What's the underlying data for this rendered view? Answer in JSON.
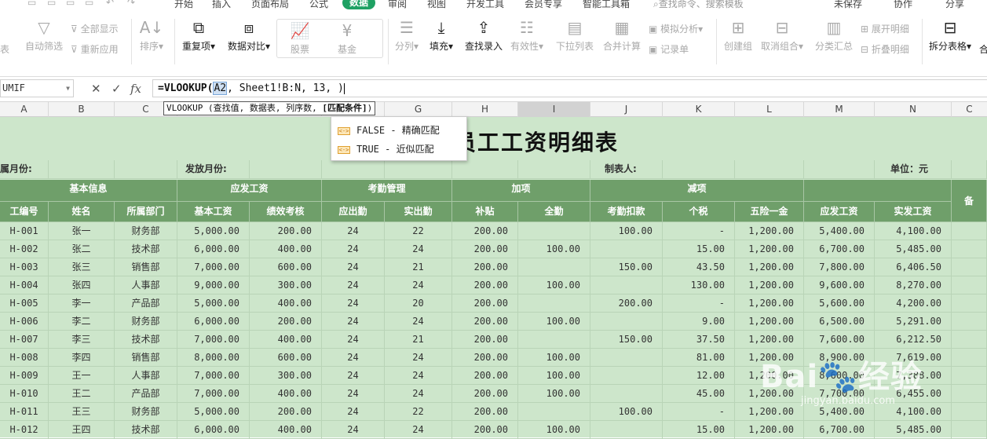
{
  "menubar": {
    "tabs": [
      "开始",
      "插入",
      "页面布局",
      "公式",
      "数据",
      "审阅",
      "视图",
      "开发工具",
      "会员专享",
      "智能工具箱"
    ],
    "active_tab": "数据",
    "search_hint": "查找命令、搜索模板",
    "right": [
      "未保存",
      "协作",
      "分享"
    ]
  },
  "ribbon": {
    "cut_left": "表",
    "auto_filter": "自动筛选",
    "show_all": "全部显示",
    "reapply": "重新应用",
    "sort": "排序",
    "duplicates": "重复项",
    "compare": "数据对比",
    "stock": "股票",
    "fund": "基金",
    "split": "分列",
    "fill": "填充",
    "lookup": "查找录入",
    "validity": "有效性",
    "dropdown": "下拉列表",
    "merge_calc": "合并计算",
    "simulate": "模拟分析",
    "record": "记录单",
    "create_group": "创建组",
    "ungroup": "取消组合",
    "subtotal": "分类汇总",
    "expand": "展开明细",
    "collapse": "折叠明细",
    "split_table": "拆分表格",
    "cut_right": "合"
  },
  "formula_bar": {
    "name_box": "UMIF",
    "fx": "fx",
    "prefix": "=VLOOKUP(",
    "ref": "A2",
    "suffix": ", Sheet1!B:N, 13, )"
  },
  "tooltip": {
    "text": "VLOOKUP (查找值, 数据表, 列序数, ",
    "bold": "[匹配条件]",
    "end": ")"
  },
  "autocomplete": [
    {
      "label": "FALSE - 精确匹配"
    },
    {
      "label": "TRUE - 近似匹配"
    }
  ],
  "columns": [
    "A",
    "B",
    "C",
    "",
    "",
    "G",
    "H",
    "I",
    "J",
    "K",
    "L",
    "M",
    "N",
    "C"
  ],
  "sheet": {
    "title": "员工工资明细表",
    "title_visible": "员工工资明细表",
    "info_row": {
      "month_label": "属月份:",
      "issue_label": "发放月份:",
      "maker_label": "制表人:",
      "unit": "单位：元"
    },
    "group_headers": {
      "basic": "基本信息",
      "salary": "应发工资",
      "attendance": "考勤管理",
      "plus": "加项",
      "minus": "减项",
      "remark": "备"
    },
    "headers": [
      "工编号",
      "姓名",
      "所属部门",
      "基本工资",
      "绩效考核",
      "应出勤",
      "实出勤",
      "补贴",
      "全勤",
      "考勤扣款",
      "个税",
      "五险一金",
      "应发工资",
      "实发工资"
    ],
    "rows": [
      [
        "H-001",
        "张一",
        "财务部",
        "5,000.00",
        "200.00",
        "24",
        "22",
        "200.00",
        "",
        "100.00",
        "-",
        "1,200.00",
        "5,400.00",
        "4,100.00"
      ],
      [
        "H-002",
        "张二",
        "技术部",
        "6,000.00",
        "400.00",
        "24",
        "24",
        "200.00",
        "100.00",
        "",
        "15.00",
        "1,200.00",
        "6,700.00",
        "5,485.00"
      ],
      [
        "H-003",
        "张三",
        "销售部",
        "7,000.00",
        "600.00",
        "24",
        "21",
        "200.00",
        "",
        "150.00",
        "43.50",
        "1,200.00",
        "7,800.00",
        "6,406.50"
      ],
      [
        "H-004",
        "张四",
        "人事部",
        "9,000.00",
        "300.00",
        "24",
        "24",
        "200.00",
        "100.00",
        "",
        "130.00",
        "1,200.00",
        "9,600.00",
        "8,270.00"
      ],
      [
        "H-005",
        "李一",
        "产品部",
        "5,000.00",
        "400.00",
        "24",
        "20",
        "200.00",
        "",
        "200.00",
        "-",
        "1,200.00",
        "5,600.00",
        "4,200.00"
      ],
      [
        "H-006",
        "李二",
        "财务部",
        "6,000.00",
        "200.00",
        "24",
        "24",
        "200.00",
        "100.00",
        "",
        "9.00",
        "1,200.00",
        "6,500.00",
        "5,291.00"
      ],
      [
        "H-007",
        "李三",
        "技术部",
        "7,000.00",
        "400.00",
        "24",
        "21",
        "200.00",
        "",
        "150.00",
        "37.50",
        "1,200.00",
        "7,600.00",
        "6,212.50"
      ],
      [
        "H-008",
        "李四",
        "销售部",
        "8,000.00",
        "600.00",
        "24",
        "24",
        "200.00",
        "100.00",
        "",
        "81.00",
        "1,200.00",
        "8,900.00",
        "7,619.00"
      ],
      [
        "H-009",
        "王一",
        "人事部",
        "7,000.00",
        "300.00",
        "24",
        "24",
        "200.00",
        "100.00",
        "",
        "12.00",
        "1,200.00",
        "8,600.00",
        "7,388.00"
      ],
      [
        "H-010",
        "王二",
        "产品部",
        "7,000.00",
        "400.00",
        "24",
        "24",
        "200.00",
        "100.00",
        "",
        "45.00",
        "1,200.00",
        "7,700.00",
        "6,455.00"
      ],
      [
        "H-011",
        "王三",
        "财务部",
        "5,000.00",
        "200.00",
        "24",
        "22",
        "200.00",
        "",
        "100.00",
        "-",
        "1,200.00",
        "5,400.00",
        "4,100.00"
      ],
      [
        "H-012",
        "王四",
        "技术部",
        "6,000.00",
        "400.00",
        "24",
        "24",
        "200.00",
        "100.00",
        "",
        "15.00",
        "1,200.00",
        "6,700.00",
        "5,485.00"
      ]
    ]
  },
  "watermark": {
    "big": "Bai🐾经验",
    "small": "jingyan.baidu.com"
  }
}
